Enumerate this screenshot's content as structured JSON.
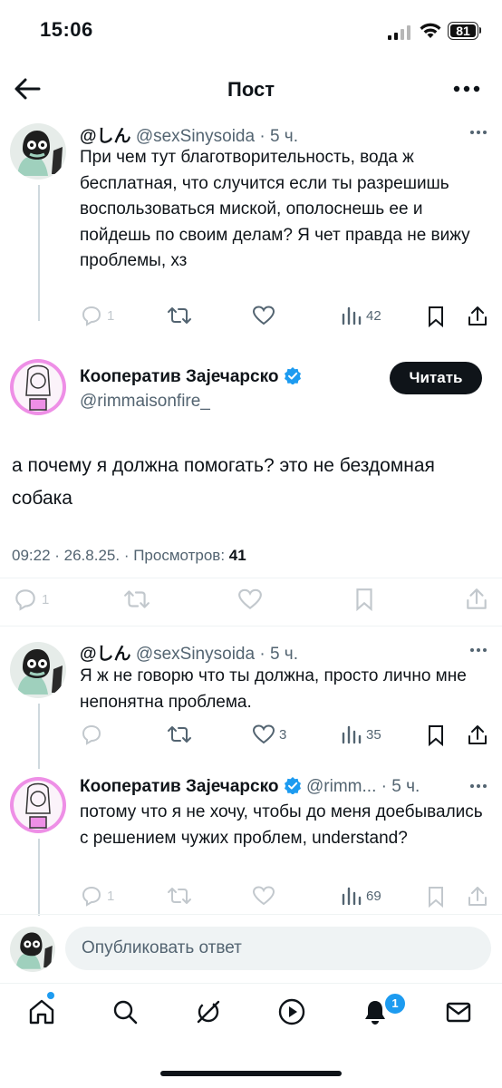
{
  "status_bar": {
    "time": "15:06",
    "battery": "81"
  },
  "header": {
    "title": "Пост"
  },
  "tweets": [
    {
      "name": "@しん",
      "handle": "@sexSinysoida",
      "time": "· 5 ч.",
      "text": "При чем тут благотворительность, вода ж бесплатная, что случится если ты разрешишь воспользоваться миской, ополоснешь ее и пойдешь по своим делам? Я чет правда не вижу проблемы, хз",
      "replies": "1",
      "likes": "",
      "views": "42"
    },
    {
      "name": "Кооператив Зајечарско",
      "handle": "@rimmaisonfire_",
      "follow_label": "Читать",
      "text": "а почему я должна помогать? это не бездомная собака",
      "timestamp": "09:22 · 26.8.25. · Просмотров:",
      "views": "41",
      "replies": "1"
    },
    {
      "name": "@しん",
      "handle": "@sexSinysoida",
      "time": "· 5 ч.",
      "text": "Я ж не говорю что ты должна, просто лично мне непонятна проблема.",
      "replies": "",
      "likes": "3",
      "views": "35"
    },
    {
      "name": "Кооператив Зајечарско",
      "handle": "@rimm...",
      "time": "· 5 ч.",
      "text": "потому что я не хочу, чтобы до меня доебывались с решением чужих проблем, understand?",
      "replies": "1",
      "likes": "",
      "views": "69"
    }
  ],
  "reply_box": {
    "placeholder": "Опубликовать ответ"
  },
  "bottom_nav": {
    "notifications_badge": "1"
  },
  "colors": {
    "accent": "#1d9bf0",
    "text": "#0f1419",
    "secondary": "#536471",
    "follow_button": "#0f1419"
  }
}
